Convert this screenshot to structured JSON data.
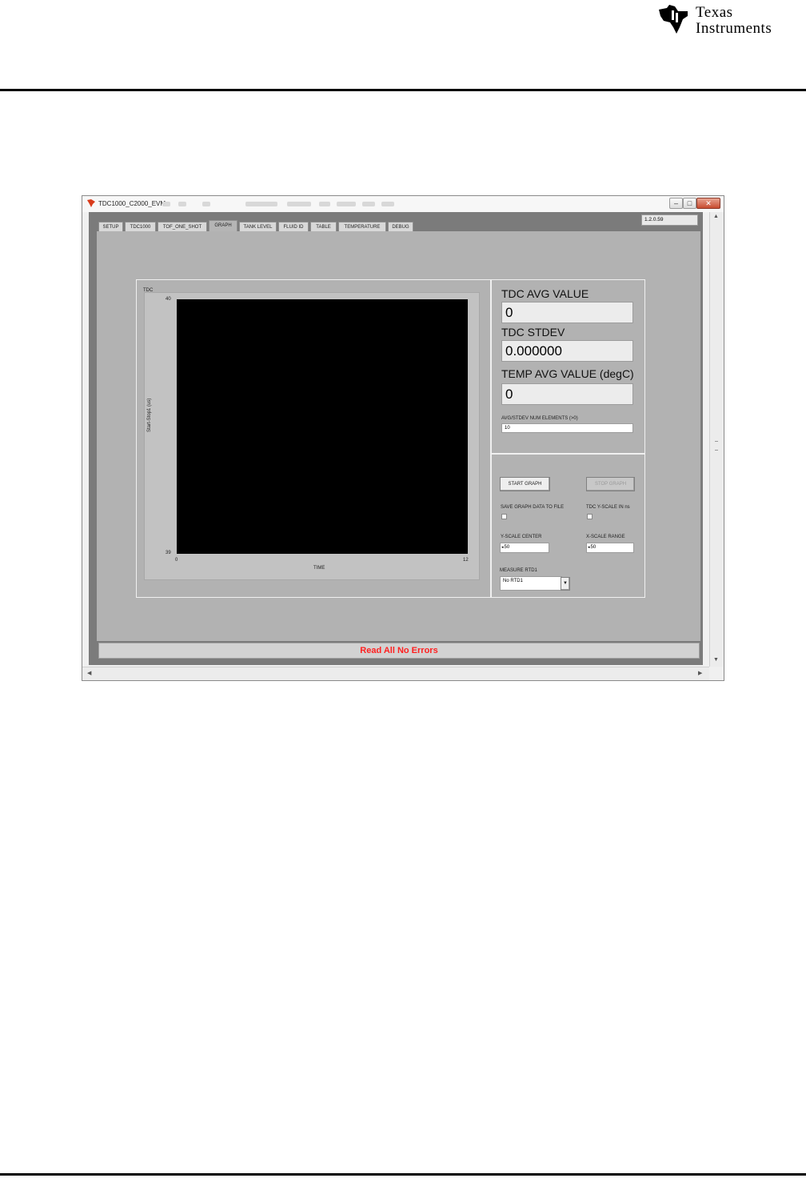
{
  "document": {
    "logo_line1": "Texas",
    "logo_line2": "Instruments"
  },
  "window": {
    "title": "TDC1000_C2000_EVM",
    "version": "1.2.0.59"
  },
  "tabs": [
    {
      "label": "SETUP"
    },
    {
      "label": "TDC1000"
    },
    {
      "label": "TOF_ONE_SHOT"
    },
    {
      "label": "GRAPH",
      "active": true
    },
    {
      "label": "TANK LEVEL"
    },
    {
      "label": "FLUID ID"
    },
    {
      "label": "TABLE"
    },
    {
      "label": "TEMPERATURE"
    },
    {
      "label": "DEBUG"
    }
  ],
  "graph": {
    "title": "TDC",
    "y_axis_label": "Start-Stop1 (us)",
    "x_axis_label": "TIME",
    "y_max_tick": "40",
    "y_min_tick": "39",
    "x_min_tick": "0",
    "x_max_tick": "12",
    "plot_background": "#000000"
  },
  "values": {
    "tdc_avg_label": "TDC AVG VALUE",
    "tdc_avg_value": "0",
    "tdc_stdev_label": "TDC STDEV",
    "tdc_stdev_value": "0.000000",
    "temp_avg_label": "TEMP AVG VALUE (degC)",
    "temp_avg_value": "0",
    "num_elements_label": "AVG/STDEV NUM ELEMENTS (>0)",
    "num_elements_value": "10"
  },
  "controls": {
    "start_graph": "START GRAPH",
    "stop_graph": "STOP GRAPH",
    "save_graph_label": "SAVE GRAPH DATA TO FILE",
    "y_scale_ns_label": "TDC Y-SCALE IN ns",
    "y_scale_center_label": "Y-SCALE CENTER",
    "y_scale_center_value": "50",
    "x_scale_range_label": "X-SCALE RANGE",
    "x_scale_range_value": "50",
    "measure_rtd1_label": "MEASURE RTD1",
    "measure_rtd1_value": "No RTD1"
  },
  "status": {
    "message": "Read All No Errors",
    "color": "#ff2020"
  }
}
